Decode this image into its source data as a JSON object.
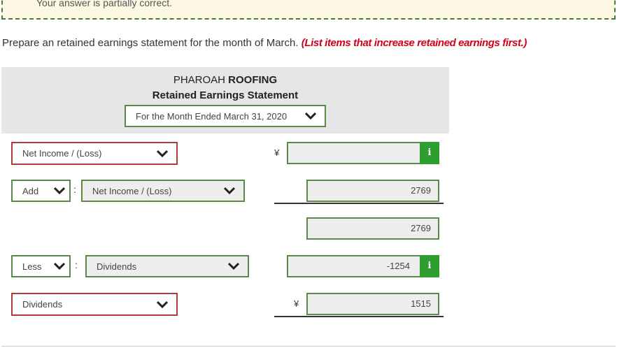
{
  "banner": {
    "text": "Your answer is partially correct."
  },
  "instructions": {
    "text": "Prepare an retained earnings statement for the month of March.",
    "note": "(List items that increase retained earnings first.)"
  },
  "statement": {
    "company_prefix": "PHAROAH",
    "company_bold": "ROOFING",
    "title": "Retained Earnings Statement",
    "period": "For the Month Ended March 31, 2020"
  },
  "rows": {
    "r1": {
      "label": "Net Income / (Loss)",
      "currency": "¥",
      "amount": ""
    },
    "r2": {
      "op": "Add",
      "label": "Net Income / (Loss)",
      "amount": "2769"
    },
    "r3": {
      "amount": "2769"
    },
    "r4": {
      "op": "Less",
      "label": "Dividends",
      "amount": "-1254"
    },
    "r5": {
      "label": "Dividends",
      "currency": "¥",
      "amount": "1515"
    }
  },
  "info_icon": {
    "glyph": "i",
    "name": "info-icon"
  },
  "colors": {
    "correct": "#5a8a4a",
    "incorrect": "#b23a3a",
    "info": "#2e9e2e",
    "note": "#d0021b"
  }
}
